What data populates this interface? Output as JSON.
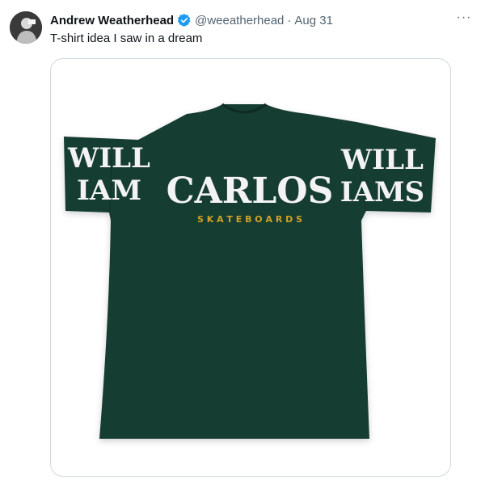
{
  "tweet": {
    "author_name": "Andrew Weatherhead",
    "handle": "@weeatherhead",
    "separator": "·",
    "date": "Aug 31",
    "text": "T-shirt idea I saw in a dream",
    "more_label": "···"
  },
  "image": {
    "sleeve_left_line1": "WILL",
    "sleeve_left_line2": "IAM",
    "chest_main": "CARLOS",
    "chest_sub": "S K A T E B O A R D S",
    "sleeve_right_line1": "WILL",
    "sleeve_right_line2": "IAMS",
    "shirt_color": "#173d32",
    "print_color": "#f3f3f3",
    "accent_color": "#d2a126"
  },
  "colors": {
    "verified": "#1d9bf0",
    "secondary_text": "#536471"
  }
}
